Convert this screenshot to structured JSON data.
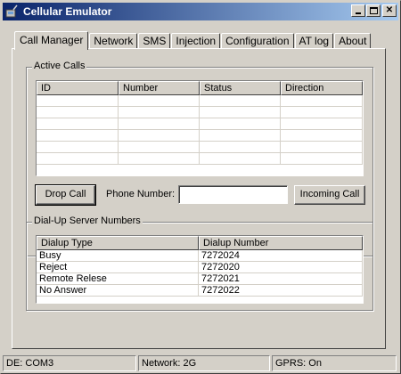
{
  "window": {
    "title": "Cellular Emulator",
    "minimize_label": "_",
    "maximize_label": "□",
    "close_label": "✕"
  },
  "tabs": [
    {
      "label": "Call Manager",
      "active": true
    },
    {
      "label": "Network",
      "active": false
    },
    {
      "label": "SMS",
      "active": false
    },
    {
      "label": "Injection",
      "active": false
    },
    {
      "label": "Configuration",
      "active": false
    },
    {
      "label": "AT log",
      "active": false
    },
    {
      "label": "About",
      "active": false
    }
  ],
  "active_calls": {
    "group_label": "Active Calls",
    "columns": [
      "ID",
      "Number",
      "Status",
      "Direction"
    ],
    "rows": [
      [
        "",
        "",
        "",
        ""
      ],
      [
        "",
        "",
        "",
        ""
      ],
      [
        "",
        "",
        "",
        ""
      ],
      [
        "",
        "",
        "",
        ""
      ],
      [
        "",
        "",
        "",
        ""
      ],
      [
        "",
        "",
        "",
        ""
      ]
    ],
    "drop_call_label": "Drop Call",
    "phone_number_label": "Phone Number:",
    "phone_number_value": "",
    "incoming_call_label": "Incoming Call"
  },
  "dialup": {
    "group_label": "Dial-Up Server Numbers",
    "columns": [
      "Dialup Type",
      "Dialup Number"
    ],
    "rows": [
      [
        "Busy",
        "7272024"
      ],
      [
        "Reject",
        "7272020"
      ],
      [
        "Remote Relese",
        "7272021"
      ],
      [
        "No Answer",
        "7272022"
      ]
    ]
  },
  "statusbar": {
    "device": "DE: COM3",
    "network": "Network: 2G",
    "gprs": "GPRS: On"
  }
}
